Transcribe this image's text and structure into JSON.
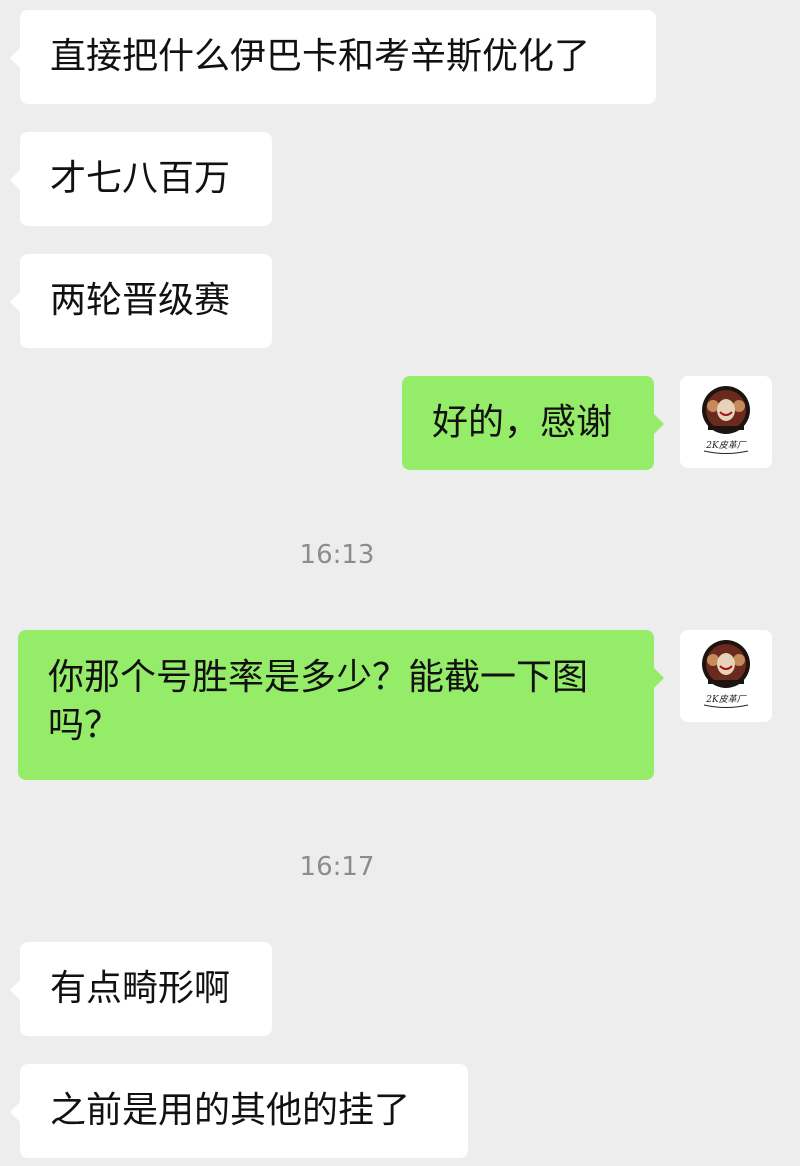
{
  "chat": {
    "messages": [
      {
        "from": "other",
        "text": "直接把什么伊巴卡和考辛斯优化了"
      },
      {
        "from": "other",
        "text": "才七八百万"
      },
      {
        "from": "other",
        "text": "两轮晋级赛"
      },
      {
        "from": "self",
        "text": "好的，感谢"
      },
      {
        "type": "time",
        "text": "16:13"
      },
      {
        "from": "self",
        "text": "你那个号胜率是多少？能截一下图吗？"
      },
      {
        "type": "time",
        "text": "16:17"
      },
      {
        "from": "other",
        "text": "有点畸形啊"
      },
      {
        "from": "other",
        "text": "之前是用的其他的挂了"
      }
    ]
  },
  "avatar": {
    "icon": "joker-avatar-icon",
    "caption": "2K皮革厂"
  },
  "colors": {
    "background": "#ededed",
    "incoming_bubble": "#ffffff",
    "outgoing_bubble": "#95ec69",
    "timestamp": "#8c8c8c",
    "text": "#111111"
  }
}
